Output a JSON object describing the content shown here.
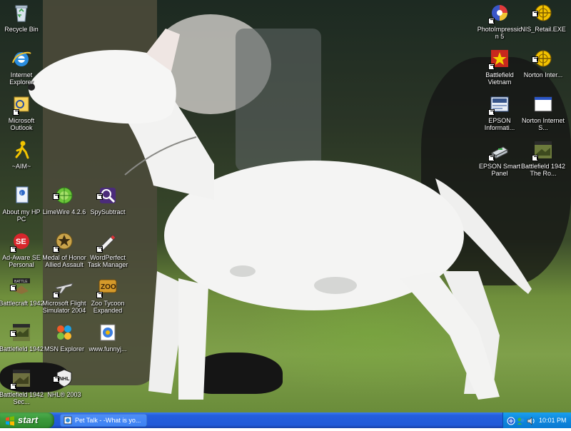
{
  "desktop": {
    "icons": [
      {
        "label": "Recycle Bin",
        "icon": "recycle-bin-icon"
      },
      {
        "label": "Internet Explorer",
        "icon": "internet-explorer-icon"
      },
      {
        "label": "Microsoft Outlook",
        "icon": "outlook-icon"
      },
      {
        "label": "~AIM~",
        "icon": "aim-icon"
      },
      {
        "label": "About my HP PC",
        "icon": "hp-info-icon"
      },
      {
        "label": "LimeWire 4.2.6",
        "icon": "limewire-icon"
      },
      {
        "label": "SpySubtract",
        "icon": "spysubtract-icon"
      },
      {
        "label": "Ad-Aware SE Personal",
        "icon": "ad-aware-icon"
      },
      {
        "label": "Medal of Honor Allied Assault",
        "icon": "medal-of-honor-icon"
      },
      {
        "label": "WordPerfect Task Manager",
        "icon": "wordperfect-icon"
      },
      {
        "label": "Battlecraft 1942",
        "icon": "battlecraft-icon"
      },
      {
        "label": "Microsoft Flight Simulator 2004",
        "icon": "flight-simulator-icon"
      },
      {
        "label": "Zoo Tycoon Expanded",
        "icon": "zoo-tycoon-icon"
      },
      {
        "label": "Battlefield 1942",
        "icon": "battlefield-icon"
      },
      {
        "label": "MSN Explorer",
        "icon": "msn-butterfly-icon"
      },
      {
        "label": "www.funnyj...",
        "icon": "web-shortcut-icon"
      },
      {
        "label": "Battlefield 1942 Sec...",
        "icon": "battlefield-icon"
      },
      {
        "label": "NHL® 2003",
        "icon": "nhl-icon"
      },
      {
        "label": "PhotoImpression 5",
        "icon": "photoimpression-icon"
      },
      {
        "label": "NIS_Retail.EXE",
        "icon": "norton-icon"
      },
      {
        "label": "Battlefield Vietnam",
        "icon": "battlefield-vietnam-icon"
      },
      {
        "label": "Norton Inter...",
        "icon": "norton-icon"
      },
      {
        "label": "EPSON Informati...",
        "icon": "epson-info-icon"
      },
      {
        "label": "Norton Internet S...",
        "icon": "norton-window-icon"
      },
      {
        "label": "EPSON Smart Panel",
        "icon": "epson-smart-panel-icon"
      },
      {
        "label": "Battlefield 1942 The Ro...",
        "icon": "battlefield-icon"
      }
    ]
  },
  "taskbar": {
    "start_label": "start",
    "tasks": [
      {
        "label": "Pet Talk - -What is yo...",
        "icon": "web-page-icon"
      }
    ],
    "tray": {
      "icons": [
        "network-icon",
        "messenger-icon",
        "volume-icon"
      ],
      "clock": "10:01 PM"
    }
  },
  "colors": {
    "taskbar_blue": "#245edc",
    "start_green": "#3c9a3c",
    "tray_blue": "#0f8ae0"
  }
}
